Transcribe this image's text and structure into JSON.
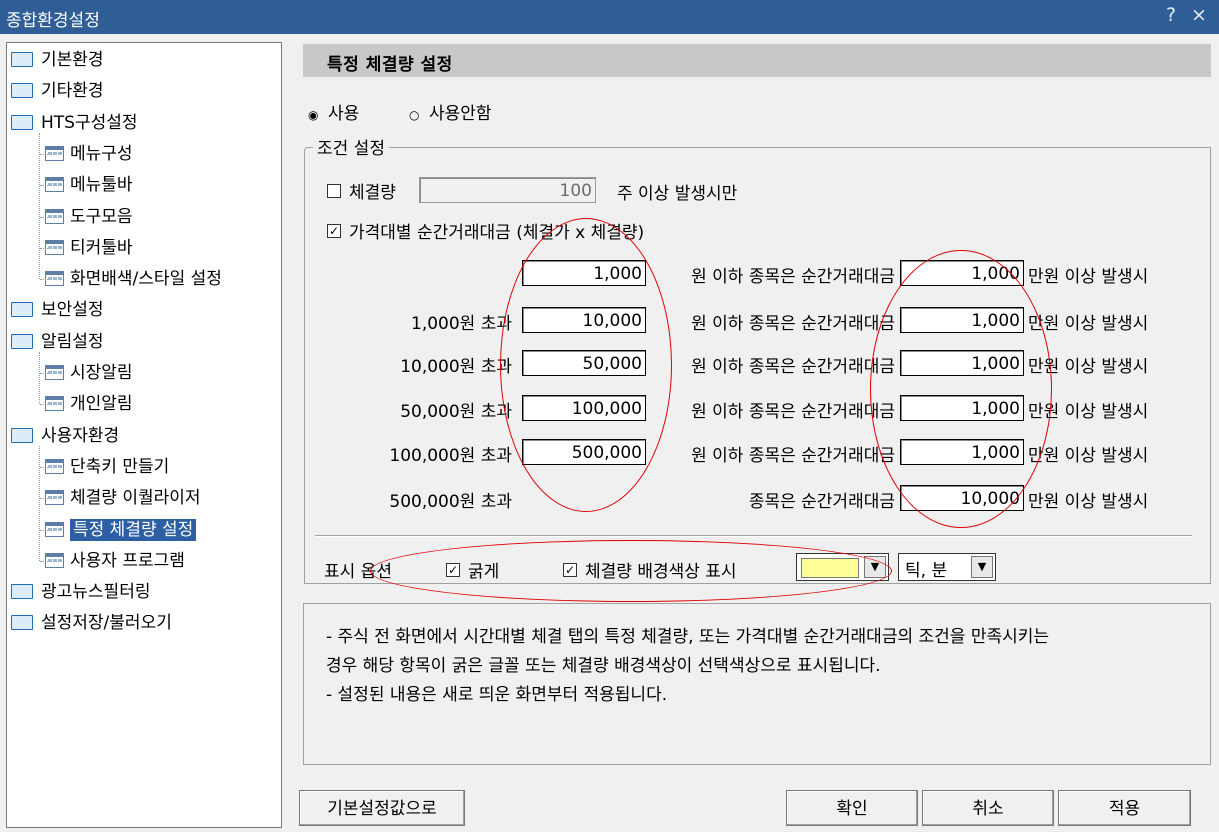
{
  "window": {
    "title": "종합환경설정",
    "help": "?",
    "close": "×"
  },
  "tree": [
    {
      "label": "기본환경",
      "type": "folder"
    },
    {
      "label": "기타환경",
      "type": "folder"
    },
    {
      "label": "HTS구성설정",
      "type": "folder"
    },
    {
      "label": "메뉴구성",
      "type": "doc"
    },
    {
      "label": "메뉴툴바",
      "type": "doc"
    },
    {
      "label": "도구모음",
      "type": "doc"
    },
    {
      "label": "티커툴바",
      "type": "doc"
    },
    {
      "label": "화면배색/스타일 설정",
      "type": "doc"
    },
    {
      "label": "보안설정",
      "type": "folder"
    },
    {
      "label": "알림설정",
      "type": "folder"
    },
    {
      "label": "시장알림",
      "type": "doc"
    },
    {
      "label": "개인알림",
      "type": "doc"
    },
    {
      "label": "사용자환경",
      "type": "folder"
    },
    {
      "label": "단축키 만들기",
      "type": "doc"
    },
    {
      "label": "체결량 이퀄라이저",
      "type": "doc"
    },
    {
      "label": "특정 체결량 설정",
      "type": "doc",
      "selected": true
    },
    {
      "label": "사용자 프로그램",
      "type": "doc"
    },
    {
      "label": "광고뉴스필터링",
      "type": "folder"
    },
    {
      "label": "설정저장/불러오기",
      "type": "folder"
    }
  ],
  "panel": {
    "title": "특정 체결량 설정",
    "radio_use": "사용",
    "radio_nouse": "사용안함",
    "radio_selected": "사용",
    "group_label": "조건 설정",
    "qty": {
      "label": "체결량",
      "value": "100",
      "suffix": "주 이상 발생시만",
      "checked": false
    },
    "price": {
      "label": "가격대별 순간거래대금 (체결가 x 체결량)",
      "checked": true
    },
    "rows": [
      {
        "prefix": "",
        "upto": "1,000",
        "mid": "원 이하 종목은 순간거래대금",
        "amount": "1,000",
        "tail": "만원 이상 발생시"
      },
      {
        "prefix": "1,000원 초과",
        "upto": "10,000",
        "mid": "원 이하 종목은 순간거래대금",
        "amount": "1,000",
        "tail": "만원 이상 발생시"
      },
      {
        "prefix": "10,000원 초과",
        "upto": "50,000",
        "mid": "원 이하 종목은 순간거래대금",
        "amount": "1,000",
        "tail": "만원 이상 발생시"
      },
      {
        "prefix": "50,000원 초과",
        "upto": "100,000",
        "mid": "원 이하 종목은 순간거래대금",
        "amount": "1,000",
        "tail": "만원 이상 발생시"
      },
      {
        "prefix": "100,000원 초과",
        "upto": "500,000",
        "mid": "원 이하 종목은 순간거래대금",
        "amount": "1,000",
        "tail": "만원 이상 발생시"
      },
      {
        "prefix": "500,000원 초과",
        "upto": "",
        "mid": "종목은 순간거래대금",
        "amount": "10,000",
        "tail": "만원 이상 발생시"
      }
    ],
    "display": {
      "label": "표시 옵션",
      "bold_label": "굵게",
      "bold_checked": true,
      "bg_label": "체결량 배경색상 표시",
      "bg_checked": true,
      "bg_color": "#ffff99",
      "unit_value": "틱, 분"
    },
    "info_lines": [
      "- 주식 전 화면에서 시간대별 체결 탭의 특정 체결량, 또는 가격대별 순간거래대금의 조건을 만족시키는",
      "경우 해당 항목이 굵은 글꼴 또는 체결량 배경색상이 선택색상으로 표시됩니다.",
      "- 설정된 내용은 새로 띄운 화면부터 적용됩니다."
    ]
  },
  "buttons": {
    "default": "기본설정값으로",
    "ok": "확인",
    "cancel": "취소",
    "apply": "적용"
  },
  "colors": {
    "titlebar": "#2f5d95",
    "selection": "#2c5fa3",
    "annotation": "#e00000"
  }
}
